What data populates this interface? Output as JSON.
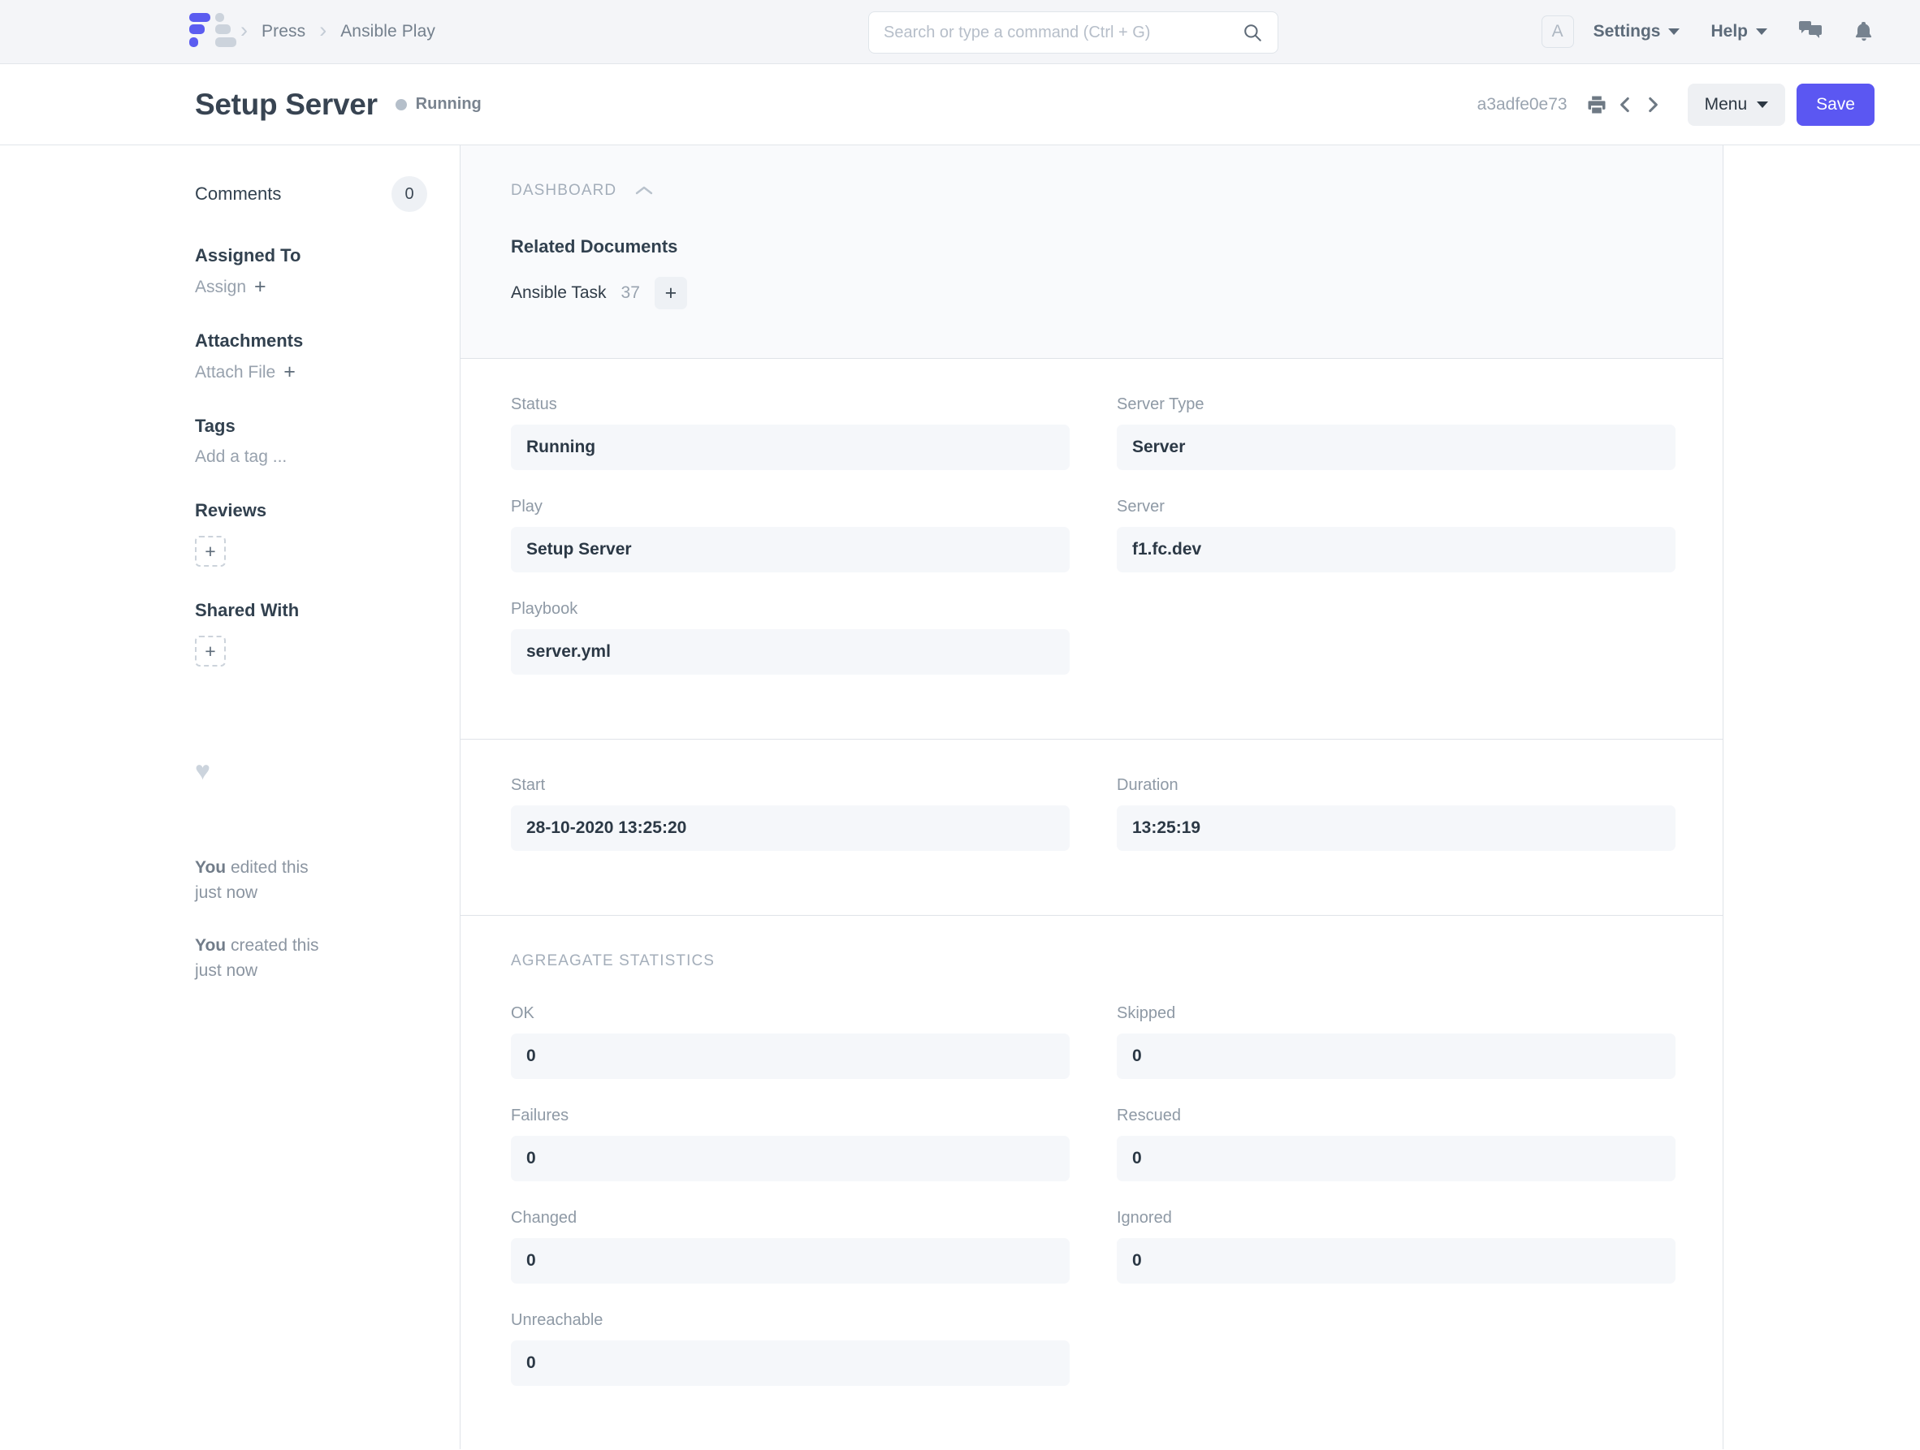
{
  "navbar": {
    "breadcrumbs": [
      {
        "label": "Press"
      },
      {
        "label": "Ansible Play"
      }
    ],
    "search": {
      "placeholder": "Search or type a command (Ctrl + G)",
      "value": ""
    },
    "avatar_initial": "A",
    "settings_label": "Settings",
    "help_label": "Help"
  },
  "titlebar": {
    "title": "Setup Server",
    "status": "Running",
    "doc_id": "a3adfe0e73",
    "menu_label": "Menu",
    "save_label": "Save",
    "accent_color": "#5b57f2"
  },
  "sidebar": {
    "comments_label": "Comments",
    "comments_count": "0",
    "assigned_to_label": "Assigned To",
    "assign_label": "Assign",
    "attachments_label": "Attachments",
    "attach_file_label": "Attach File",
    "tags_label": "Tags",
    "add_tag_label": "Add a tag ...",
    "reviews_label": "Reviews",
    "shared_with_label": "Shared With",
    "activity": [
      {
        "actor": "You",
        "text": "edited this",
        "time": "just now"
      },
      {
        "actor": "You",
        "text": "created this",
        "time": "just now"
      }
    ]
  },
  "main": {
    "dashboard": {
      "section_label": "DASHBOARD",
      "related_documents_label": "Related Documents",
      "related": [
        {
          "name": "Ansible Task",
          "count": "37"
        }
      ]
    },
    "details": {
      "fields": [
        {
          "label": "Status",
          "value": "Running"
        },
        {
          "label": "Server Type",
          "value": "Server"
        },
        {
          "label": "Play",
          "value": "Setup Server"
        },
        {
          "label": "Server",
          "value": "f1.fc.dev"
        },
        {
          "label": "Playbook",
          "value": "server.yml"
        }
      ]
    },
    "timing": {
      "fields": [
        {
          "label": "Start",
          "value": "28-10-2020 13:25:20"
        },
        {
          "label": "Duration",
          "value": "13:25:19"
        }
      ]
    },
    "statistics": {
      "section_label": "AGREAGATE STATISTICS",
      "fields": [
        {
          "label": "OK",
          "value": "0"
        },
        {
          "label": "Skipped",
          "value": "0"
        },
        {
          "label": "Failures",
          "value": "0"
        },
        {
          "label": "Rescued",
          "value": "0"
        },
        {
          "label": "Changed",
          "value": "0"
        },
        {
          "label": "Ignored",
          "value": "0"
        },
        {
          "label": "Unreachable",
          "value": "0"
        }
      ]
    }
  }
}
